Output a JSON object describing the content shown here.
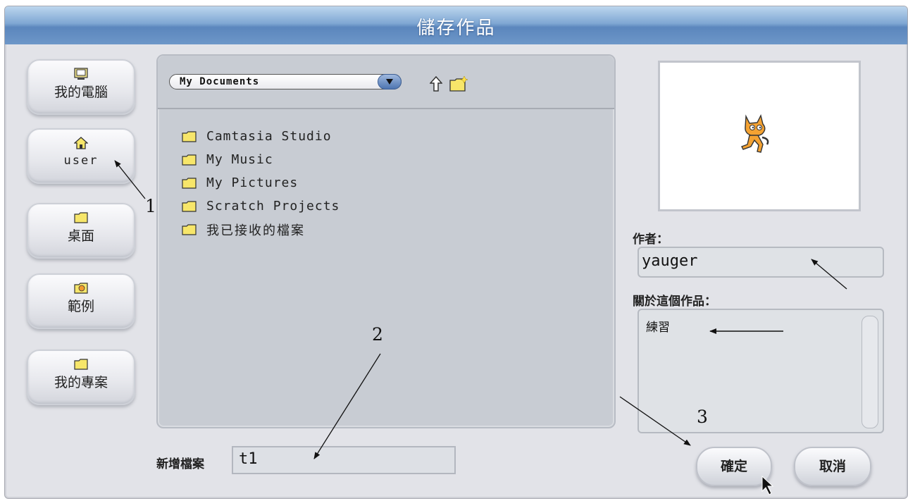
{
  "dialog": {
    "title": "儲存作品"
  },
  "sidebar": {
    "items": [
      {
        "label": "我的電腦",
        "icon": "computer-icon"
      },
      {
        "label": "user",
        "icon": "home-icon"
      },
      {
        "label": "桌面",
        "icon": "folder-icon"
      },
      {
        "label": "範例",
        "icon": "cat-folder-icon"
      },
      {
        "label": "我的專案",
        "icon": "folder-icon"
      }
    ]
  },
  "browser": {
    "location": "My Documents",
    "files": [
      {
        "name": "Camtasia Studio",
        "icon": "folder-icon"
      },
      {
        "name": "My Music",
        "icon": "folder-icon"
      },
      {
        "name": "My Pictures",
        "icon": "folder-icon"
      },
      {
        "name": "Scratch Projects",
        "icon": "folder-icon"
      },
      {
        "name": "我已接收的檔案",
        "icon": "folder-icon"
      }
    ]
  },
  "newfile": {
    "label": "新增檔案",
    "value": "t1"
  },
  "project": {
    "author_label": "作者：",
    "author_value": "yauger",
    "about_label": "關於這個作品：",
    "about_value": "練習"
  },
  "buttons": {
    "ok": "確定",
    "cancel": "取消"
  },
  "annotations": [
    "1",
    "2",
    "3"
  ],
  "colors": {
    "titlebar": "#6d97c8",
    "folder": "#f7e66a"
  }
}
